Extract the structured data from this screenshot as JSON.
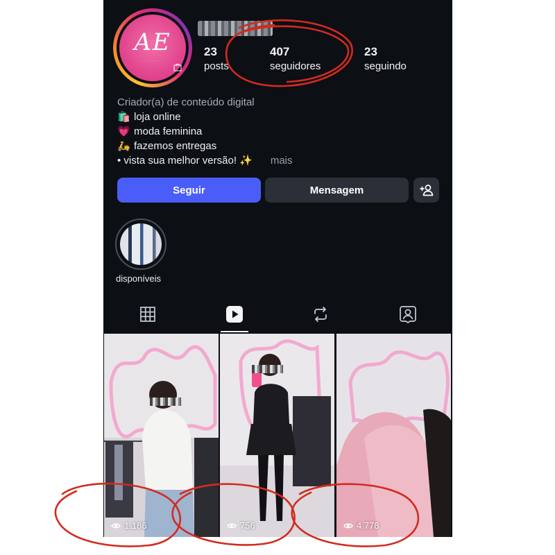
{
  "profile": {
    "logo_text": "AE",
    "posts": {
      "count": "23",
      "label": "posts"
    },
    "followers": {
      "count": "407",
      "label": "seguidores"
    },
    "following": {
      "count": "23",
      "label": "seguindo"
    }
  },
  "bio": {
    "category": "Criador(a) de conteúdo digital",
    "lines": [
      {
        "emoji": "🛍️",
        "text": "loja online"
      },
      {
        "emoji": "💗",
        "text": "moda feminina"
      },
      {
        "emoji": "🛵",
        "text": "fazemos entregas"
      }
    ],
    "last_line": "• vista sua melhor versão! ✨",
    "more": "mais"
  },
  "actions": {
    "follow": "Seguir",
    "message": "Mensagem"
  },
  "highlight": {
    "label": "disponíveis"
  },
  "tabs": [
    "grid-icon",
    "reels-icon",
    "reposts-icon",
    "tagged-icon"
  ],
  "reels": [
    {
      "views": "1.186"
    },
    {
      "views": "756"
    },
    {
      "views": "4.778"
    }
  ],
  "annotation_color": "#d42a1e",
  "accent_color": "#4a5df9"
}
